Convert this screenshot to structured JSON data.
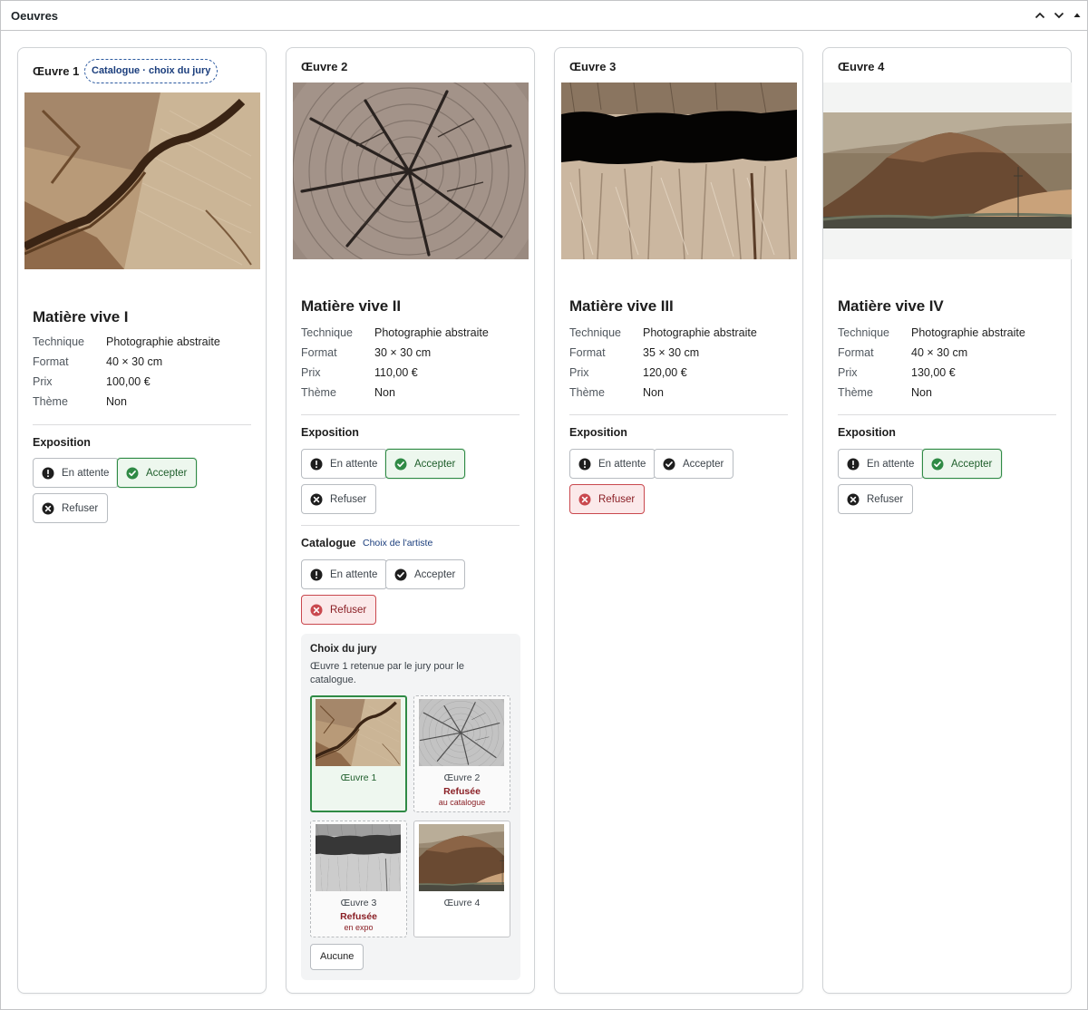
{
  "panel": {
    "title": "Oeuvres"
  },
  "cards": [
    {
      "title": "Œuvre 1",
      "badge": "Catalogue · choix du jury",
      "name": "Matière vive I",
      "meta": [
        {
          "k": "Technique",
          "v": "Photographie abstraite"
        },
        {
          "k": "Format",
          "v": "40 × 30 cm"
        },
        {
          "k": "Prix",
          "v": "100,00 €"
        },
        {
          "k": "Thème",
          "v": "Non"
        }
      ],
      "exposition": {
        "label": "Exposition",
        "pending": "En attente",
        "accept": "Accepter",
        "refuse": "Refuser",
        "state": "accept"
      }
    },
    {
      "title": "Œuvre 2",
      "name": "Matière vive II",
      "meta": [
        {
          "k": "Technique",
          "v": "Photographie abstraite"
        },
        {
          "k": "Format",
          "v": "30 × 30 cm"
        },
        {
          "k": "Prix",
          "v": "110,00 €"
        },
        {
          "k": "Thème",
          "v": "Non"
        }
      ],
      "exposition": {
        "label": "Exposition",
        "pending": "En attente",
        "accept": "Accepter",
        "refuse": "Refuser",
        "state": "accept"
      },
      "catalogue": {
        "label": "Catalogue",
        "hint": "Choix de l'artiste",
        "pending": "En attente",
        "accept": "Accepter",
        "refuse": "Refuser",
        "state": "refuse"
      },
      "jury": {
        "title": "Choix du jury",
        "desc": "Œuvre 1 retenue par le jury pour le catalogue.",
        "thumbs": [
          {
            "name": "Œuvre 1"
          },
          {
            "name": "Œuvre 2",
            "status": "Refusée",
            "sub": "au catalogue"
          },
          {
            "name": "Œuvre 3",
            "status": "Refusée",
            "sub": "en expo"
          },
          {
            "name": "Œuvre 4"
          }
        ],
        "none_label": "Aucune"
      }
    },
    {
      "title": "Œuvre 3",
      "name": "Matière vive III",
      "meta": [
        {
          "k": "Technique",
          "v": "Photographie abstraite"
        },
        {
          "k": "Format",
          "v": "35 × 30 cm"
        },
        {
          "k": "Prix",
          "v": "120,00 €"
        },
        {
          "k": "Thème",
          "v": "Non"
        }
      ],
      "exposition": {
        "label": "Exposition",
        "pending": "En attente",
        "accept": "Accepter",
        "refuse": "Refuser",
        "state": "refuse"
      }
    },
    {
      "title": "Œuvre 4",
      "name": "Matière vive IV",
      "meta": [
        {
          "k": "Technique",
          "v": "Photographie abstraite"
        },
        {
          "k": "Format",
          "v": "40 × 30 cm"
        },
        {
          "k": "Prix",
          "v": "130,00 €"
        },
        {
          "k": "Thème",
          "v": "Non"
        }
      ],
      "exposition": {
        "label": "Exposition",
        "pending": "En attente",
        "accept": "Accepter",
        "refuse": "Refuser",
        "state": "accept"
      }
    }
  ],
  "colors": {
    "accept": "#2f8a45",
    "refuse": "#c9484e",
    "accent": "#1a3d7c"
  },
  "icons": {
    "pending": "exclamation-circle-icon",
    "accept": "check-circle-icon",
    "refuse": "x-circle-icon"
  }
}
